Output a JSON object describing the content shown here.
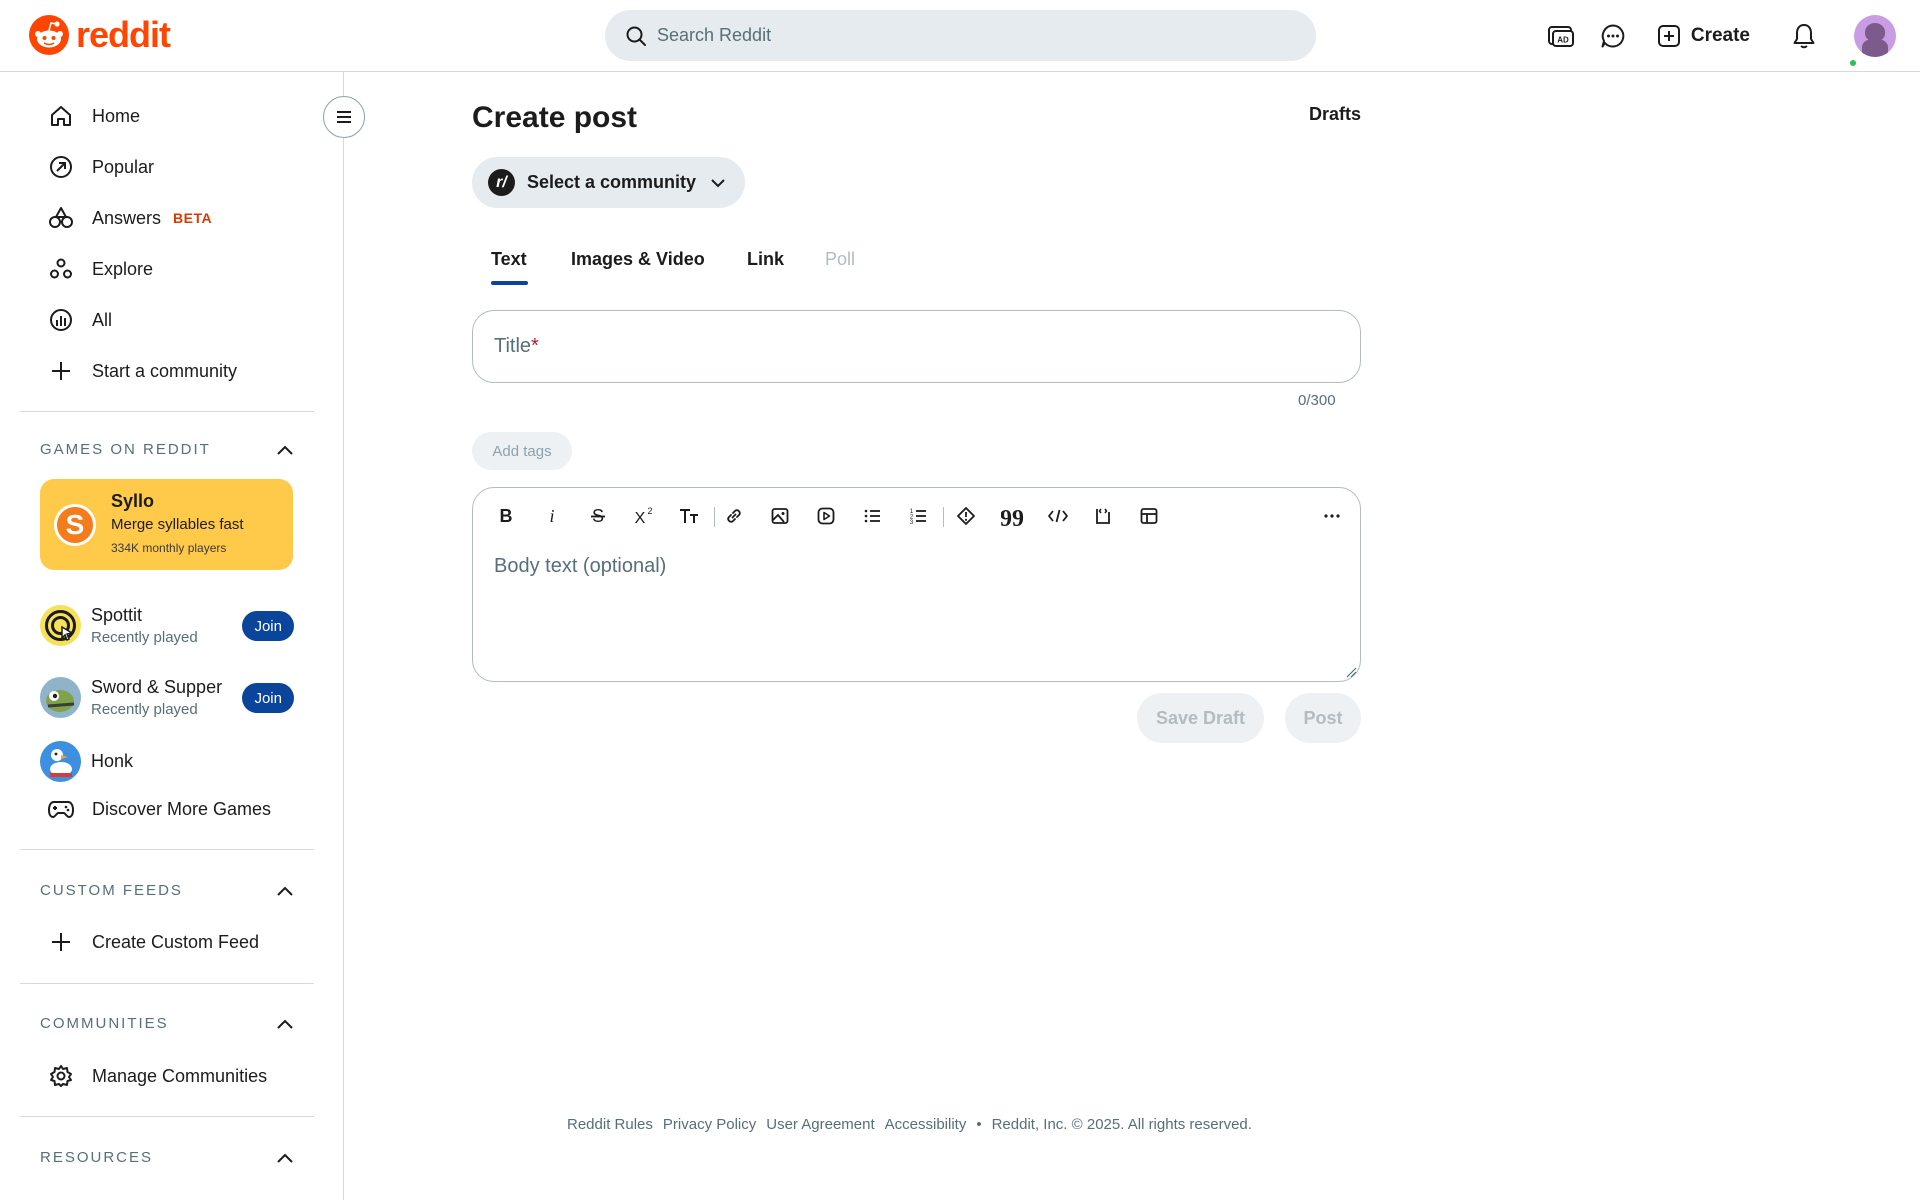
{
  "header": {
    "logo_text": "reddit",
    "search_placeholder": "Search Reddit",
    "create_label": "Create",
    "icons": [
      "advertise-icon",
      "chat-icon",
      "plus-square-icon",
      "bell-icon"
    ],
    "brand_color": "#ff4500"
  },
  "sidebar": {
    "nav": [
      {
        "label": "Home",
        "icon": "home-icon"
      },
      {
        "label": "Popular",
        "icon": "popular-arrow-icon"
      },
      {
        "label": "Answers",
        "icon": "answers-icon",
        "badge": "BETA"
      },
      {
        "label": "Explore",
        "icon": "explore-icon"
      },
      {
        "label": "All",
        "icon": "all-chart-icon"
      },
      {
        "label": "Start a community",
        "icon": "plus-icon"
      }
    ],
    "games": {
      "title": "GAMES ON REDDIT",
      "featured": {
        "name": "Syllo",
        "tagline": "Merge syllables fast",
        "players": "334K monthly players",
        "icon_letter": "S"
      },
      "items": [
        {
          "name": "Spottit",
          "status": "Recently played",
          "button": "Join"
        },
        {
          "name": "Sword & Supper",
          "status": "Recently played",
          "button": "Join"
        },
        {
          "name": "Honk"
        }
      ],
      "discover": "Discover More Games"
    },
    "custom_feeds": {
      "title": "CUSTOM FEEDS",
      "create": "Create Custom Feed"
    },
    "communities": {
      "title": "COMMUNITIES",
      "manage": "Manage Communities"
    },
    "resources": {
      "title": "RESOURCES"
    }
  },
  "main": {
    "title": "Create post",
    "drafts": "Drafts",
    "community_select": "Select a community",
    "community_prefix": "r/",
    "tabs": [
      {
        "label": "Text",
        "active": true
      },
      {
        "label": "Images & Video"
      },
      {
        "label": "Link"
      },
      {
        "label": "Poll",
        "disabled": true
      }
    ],
    "title_placeholder": "Title",
    "title_required_mark": "*",
    "title_counter": "0/300",
    "add_tags": "Add tags",
    "body_placeholder": "Body text (optional)",
    "toolbar": [
      "bold-icon",
      "italic-icon",
      "strikethrough-icon",
      "superscript-icon",
      "heading-icon",
      "link-icon",
      "image-icon",
      "video-icon",
      "bullet-list-icon",
      "numbered-list-icon",
      "spoiler-icon",
      "quote-icon",
      "code-icon",
      "code-block-icon",
      "table-icon",
      "more-icon"
    ],
    "save_draft": "Save Draft",
    "post": "Post"
  },
  "footer": {
    "links": [
      "Reddit Rules",
      "Privacy Policy",
      "User Agreement",
      "Accessibility"
    ],
    "separator": "•",
    "copyright": "Reddit, Inc. © 2025. All rights reserved."
  }
}
